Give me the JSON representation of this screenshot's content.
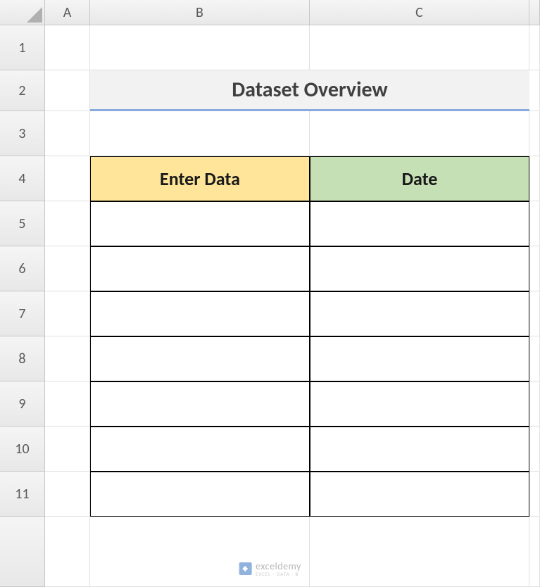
{
  "columns": [
    "A",
    "B",
    "C"
  ],
  "rows": [
    "1",
    "2",
    "3",
    "4",
    "5",
    "6",
    "7",
    "8",
    "9",
    "10",
    "11"
  ],
  "title": "Dataset Overview",
  "headers": {
    "b": "Enter Data",
    "c": "Date"
  },
  "data": {
    "b5": "",
    "c5": "",
    "b6": "",
    "c6": "",
    "b7": "",
    "c7": "",
    "b8": "",
    "c8": "",
    "b9": "",
    "c9": "",
    "b10": "",
    "c10": "",
    "b11": "",
    "c11": ""
  },
  "watermark": {
    "text": "exceldemy",
    "sub": "EXCEL · DATA · B"
  }
}
